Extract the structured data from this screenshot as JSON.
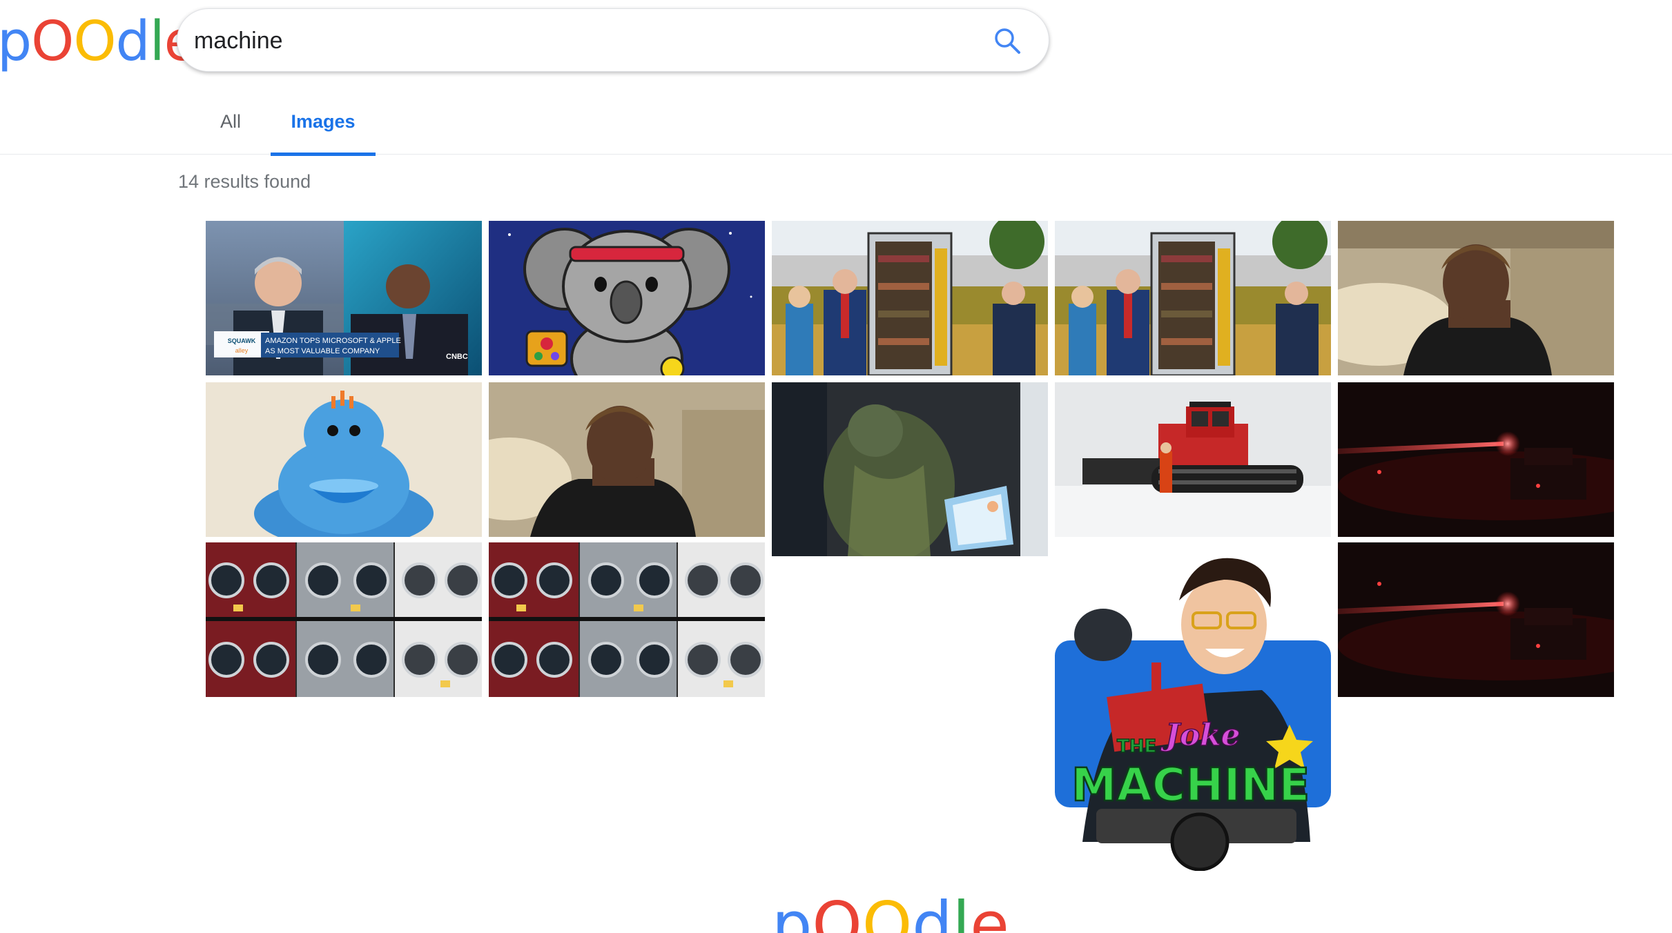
{
  "logo": {
    "letters": [
      "p",
      "O",
      "O",
      "d",
      "l",
      "e"
    ],
    "colors": [
      "#4285f4",
      "#ea4335",
      "#fbbc05",
      "#4285f4",
      "#34a853",
      "#ea4335"
    ]
  },
  "search": {
    "query": "machine",
    "icon": "search-icon",
    "icon_color": "#4285f4"
  },
  "tabs": [
    {
      "label": "All",
      "active": false
    },
    {
      "label": "Images",
      "active": true
    }
  ],
  "accent_color": "#1a73e8",
  "results": {
    "count_text": "14 results found"
  },
  "images": [
    {
      "subject": "news-anchors",
      "caption_lines": [
        "AMAZON TOPS MICROSOFT & APPLE",
        "AS MOST VALUABLE COMPANY"
      ],
      "show_label_top": "SQUAWK",
      "show_label_bottom": "alley",
      "network": "CNBC"
    },
    {
      "subject": "koala-cartoon"
    },
    {
      "subject": "vending-machine-reporters"
    },
    {
      "subject": "vending-machine-reporters"
    },
    {
      "subject": "woman-on-sofa"
    },
    {
      "subject": "blue-plush-toy"
    },
    {
      "subject": "woman-on-sofa"
    },
    {
      "subject": "woman-at-screen"
    },
    {
      "subject": "snow-groomer"
    },
    {
      "subject": "red-laser-night"
    },
    {
      "subject": "washing-machines"
    },
    {
      "subject": "washing-machines"
    },
    {
      "subject": "joke-machine-poster",
      "title_top": "THE",
      "title_script": "Joke",
      "title_main": "MACHINE"
    },
    {
      "subject": "red-laser-night"
    }
  ],
  "footer": {
    "letters": [
      "p",
      "O",
      "O",
      "d",
      "l",
      "e"
    ],
    "colors": [
      "#4285f4",
      "#ea4335",
      "#fbbc05",
      "#4285f4",
      "#34a853",
      "#ea4335"
    ]
  }
}
